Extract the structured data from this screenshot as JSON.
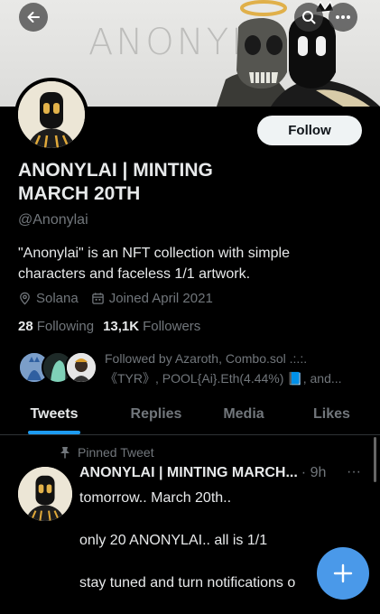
{
  "banner": {
    "wordmark": "ANONYL"
  },
  "header": {
    "back_icon": "arrow-left-icon",
    "search_icon": "search-icon",
    "more_icon": "more-dots-icon"
  },
  "profile": {
    "follow_label": "Follow",
    "name_line1": "ANONYLAI | MINTING",
    "name_line2": "MARCH 20TH",
    "handle": "@Anonylai",
    "bio_line1": "\"Anonylai\" is an NFT collection with simple",
    "bio_line2": "characters and faceless 1/1 artwork.",
    "location": "Solana",
    "joined": "Joined April 2021",
    "following_count": "28",
    "following_label": "Following",
    "followers_count": "13,1K",
    "followers_label": "Followers",
    "followed_by_line1": "Followed by Azaroth, Combo.sol .:.:.",
    "followed_by_line2": "《TYR》, POOL{Ai}.Eth(4.44%) 📘, and..."
  },
  "tabs": [
    {
      "label": "Tweets",
      "active": true
    },
    {
      "label": "Replies",
      "active": false
    },
    {
      "label": "Media",
      "active": false
    },
    {
      "label": "Likes",
      "active": false
    }
  ],
  "tweet": {
    "pinned_label": "Pinned Tweet",
    "author": "ANONYLAI | MINTING MARCH...",
    "time": "· 9h",
    "more": "···",
    "lines": [
      "tomorrow.. March 20th..",
      "only 20 ANONYLAI.. all is 1/1",
      "stay tuned and turn notifications o"
    ]
  },
  "colors": {
    "accent": "#1d9bf0",
    "fab": "#4a99e9",
    "background": "#000000",
    "muted": "#71767b"
  }
}
